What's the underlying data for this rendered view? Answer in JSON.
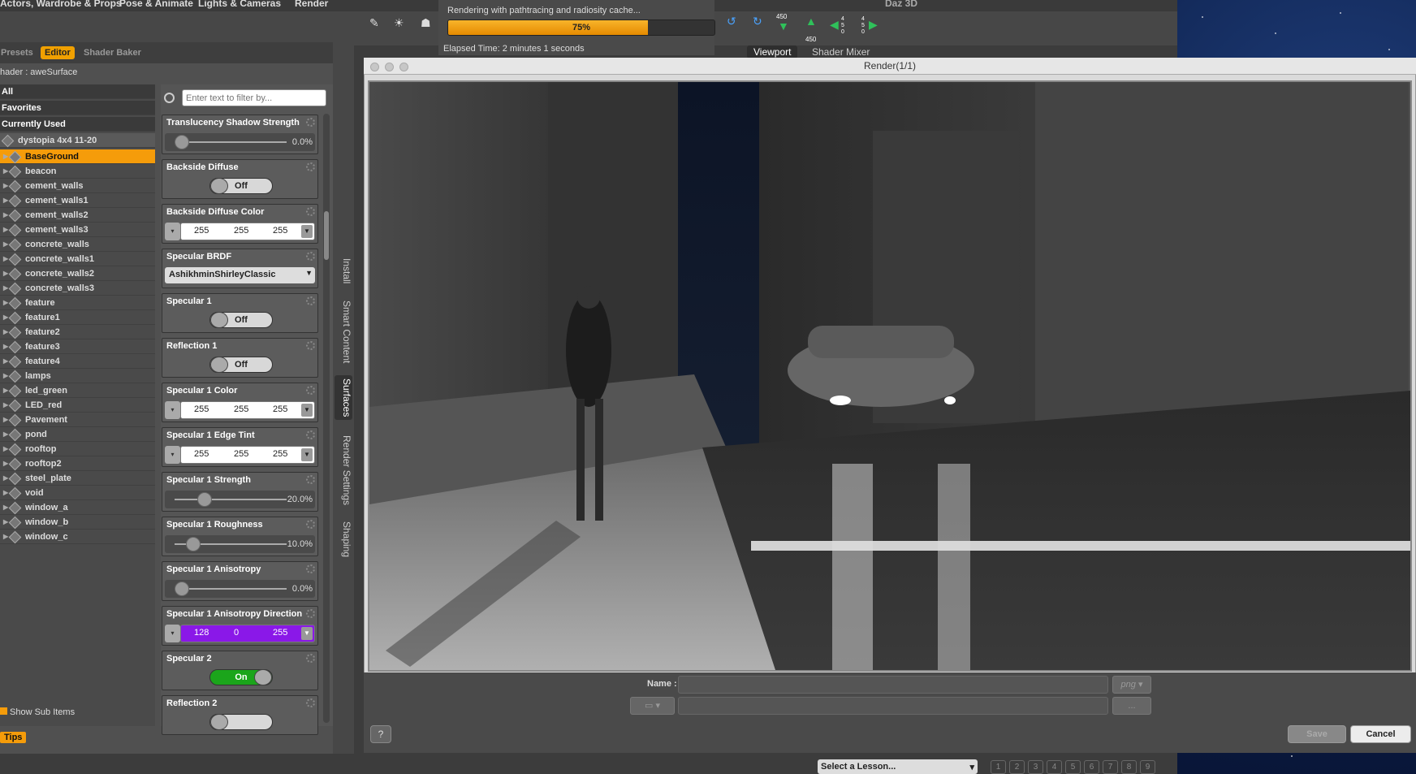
{
  "menubar": {
    "tab1": "Actors, Wardrobe & Props",
    "tab2": "Pose & Animate",
    "tab3": "Lights & Cameras",
    "tab4": "Render",
    "brand": "Daz 3D"
  },
  "toolbar": {
    "num_a": "450",
    "num_b": "450",
    "num_c": "4 5 0",
    "num_d": "4 5 0"
  },
  "progress": {
    "text": "Rendering with pathtracing and radiosity cache...",
    "percent_label": "75%",
    "fraction": 0.75,
    "elapsed": "Elapsed Time:  2 minutes 1 seconds",
    "bar_color": "#f59c0a"
  },
  "viewtabs": {
    "viewport": "Viewport",
    "shader_mixer": "Shader Mixer"
  },
  "panel": {
    "tabs": [
      "Presets",
      "Editor",
      "Shader Baker"
    ],
    "shader_label": "hader : aweSurface",
    "filter_placeholder": "Enter text to filter by...",
    "groups": [
      "All",
      "Favorites",
      "Currently Used"
    ],
    "figure": "dystopia 4x4 11-20",
    "items": [
      "BaseGround",
      "beacon",
      "cement_walls",
      "cement_walls1",
      "cement_walls2",
      "cement_walls3",
      "concrete_walls",
      "concrete_walls1",
      "concrete_walls2",
      "concrete_walls3",
      "feature",
      "feature1",
      "feature2",
      "feature3",
      "feature4",
      "lamps",
      "led_green",
      "LED_red",
      "Pavement",
      "pond",
      "rooftop",
      "rooftop2",
      "steel_plate",
      "void",
      "window_a",
      "window_b",
      "window_c"
    ],
    "show_sub": "Show Sub Items",
    "tips": "Tips"
  },
  "props": [
    {
      "title": "Translucency Shadow Strength",
      "kind": "slider",
      "value": "0.0%"
    },
    {
      "title": "Backside Diffuse",
      "kind": "toggle",
      "value": "Off"
    },
    {
      "title": "Backside Diffuse Color",
      "kind": "rgb",
      "r": "255",
      "g": "255",
      "b": "255"
    },
    {
      "title": "Specular BRDF",
      "kind": "select",
      "value": "AshikhminShirleyClassic"
    },
    {
      "title": "Specular 1",
      "kind": "toggle",
      "value": "Off"
    },
    {
      "title": "Reflection 1",
      "kind": "toggle",
      "value": "Off"
    },
    {
      "title": "Specular 1 Color",
      "kind": "rgb",
      "r": "255",
      "g": "255",
      "b": "255"
    },
    {
      "title": "Specular 1 Edge Tint",
      "kind": "rgb",
      "r": "255",
      "g": "255",
      "b": "255"
    },
    {
      "title": "Specular 1 Strength",
      "kind": "slider",
      "value": "20.0%"
    },
    {
      "title": "Specular 1 Roughness",
      "kind": "slider",
      "value": "10.0%"
    },
    {
      "title": "Specular 1 Anisotropy",
      "kind": "slider",
      "value": "0.0%"
    },
    {
      "title": "Specular 1 Anisotropy Direction",
      "kind": "rgb",
      "r": "128",
      "g": "0",
      "b": "255"
    },
    {
      "title": "Specular 2",
      "kind": "toggle",
      "value": "On"
    },
    {
      "title": "Reflection 2",
      "kind": "toggle",
      "value": ""
    }
  ],
  "sidetabs": [
    "Install",
    "Smart Content",
    "Surfaces",
    "Render Settings",
    "Shaping"
  ],
  "render": {
    "title": "Render(1/1)",
    "name_label": "Name :",
    "format": "png",
    "browse": "...",
    "help": "?",
    "save": "Save",
    "cancel": "Cancel"
  },
  "lessons": {
    "select": "Select a Lesson...",
    "pages": [
      "1",
      "2",
      "3",
      "4",
      "5",
      "6",
      "7",
      "8",
      "9"
    ]
  }
}
